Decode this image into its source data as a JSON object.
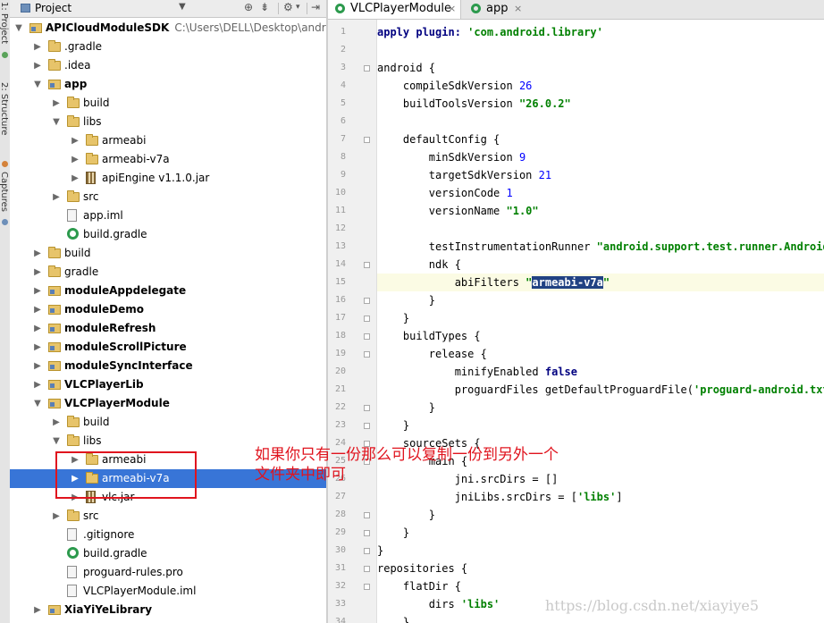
{
  "tool_strip": {
    "tabs": [
      "1: Project",
      "2: Structure",
      "Captures"
    ]
  },
  "project_panel": {
    "title": "Project",
    "dropdown_icon": "triangle-down",
    "header_buttons": [
      "gear-icon",
      "settings-dropdown-icon",
      "collapse-icon"
    ],
    "tree": [
      {
        "label": "APICloudModuleSDK",
        "path": "C:\\Users\\DELL\\Desktop\\andro",
        "type": "module",
        "depth": 0,
        "arrow": "▼",
        "bold": true
      },
      {
        "label": ".gradle",
        "type": "folder",
        "depth": 1,
        "arrow": "▶"
      },
      {
        "label": ".idea",
        "type": "folder",
        "depth": 1,
        "arrow": "▶"
      },
      {
        "label": "app",
        "type": "module",
        "depth": 1,
        "arrow": "▼",
        "bold": true
      },
      {
        "label": "build",
        "type": "folder",
        "depth": 2,
        "arrow": "▶"
      },
      {
        "label": "libs",
        "type": "folder",
        "depth": 2,
        "arrow": "▼"
      },
      {
        "label": "armeabi",
        "type": "folder",
        "depth": 3,
        "arrow": "▶"
      },
      {
        "label": "armeabi-v7a",
        "type": "folder",
        "depth": 3,
        "arrow": "▶"
      },
      {
        "label": "apiEngine v1.1.0.jar",
        "type": "jar",
        "depth": 3,
        "arrow": "▶"
      },
      {
        "label": "src",
        "type": "folder",
        "depth": 2,
        "arrow": "▶"
      },
      {
        "label": "app.iml",
        "type": "file",
        "depth": 2,
        "arrow": ""
      },
      {
        "label": "build.gradle",
        "type": "gradle",
        "depth": 2,
        "arrow": ""
      },
      {
        "label": "build",
        "type": "folder",
        "depth": 1,
        "arrow": "▶"
      },
      {
        "label": "gradle",
        "type": "folder",
        "depth": 1,
        "arrow": "▶"
      },
      {
        "label": "moduleAppdelegate",
        "type": "module",
        "depth": 1,
        "arrow": "▶",
        "bold": true
      },
      {
        "label": "moduleDemo",
        "type": "module",
        "depth": 1,
        "arrow": "▶",
        "bold": true
      },
      {
        "label": "moduleRefresh",
        "type": "module",
        "depth": 1,
        "arrow": "▶",
        "bold": true
      },
      {
        "label": "moduleScrollPicture",
        "type": "module",
        "depth": 1,
        "arrow": "▶",
        "bold": true
      },
      {
        "label": "moduleSyncInterface",
        "type": "module",
        "depth": 1,
        "arrow": "▶",
        "bold": true
      },
      {
        "label": "VLCPlayerLib",
        "type": "module",
        "depth": 1,
        "arrow": "▶",
        "bold": true
      },
      {
        "label": "VLCPlayerModule",
        "type": "module",
        "depth": 1,
        "arrow": "▼",
        "bold": true
      },
      {
        "label": "build",
        "type": "folder",
        "depth": 2,
        "arrow": "▶"
      },
      {
        "label": "libs",
        "type": "folder",
        "depth": 2,
        "arrow": "▼"
      },
      {
        "label": "armeabi",
        "type": "folder",
        "depth": 3,
        "arrow": "▶"
      },
      {
        "label": "armeabi-v7a",
        "type": "folder",
        "depth": 3,
        "arrow": "▶",
        "selected": true
      },
      {
        "label": "vlc.jar",
        "type": "jar",
        "depth": 3,
        "arrow": "▶"
      },
      {
        "label": "src",
        "type": "folder",
        "depth": 2,
        "arrow": "▶"
      },
      {
        "label": ".gitignore",
        "type": "file",
        "depth": 2,
        "arrow": ""
      },
      {
        "label": "build.gradle",
        "type": "gradle",
        "depth": 2,
        "arrow": ""
      },
      {
        "label": "proguard-rules.pro",
        "type": "file",
        "depth": 2,
        "arrow": ""
      },
      {
        "label": "VLCPlayerModule.iml",
        "type": "file",
        "depth": 2,
        "arrow": ""
      },
      {
        "label": "XiaYiYeLibrary",
        "type": "module",
        "depth": 1,
        "arrow": "▶",
        "bold": true
      }
    ]
  },
  "editor": {
    "tabs": [
      {
        "label": "VLCPlayerModule",
        "active": true,
        "close": "×"
      },
      {
        "label": "app",
        "active": false,
        "close": "×"
      }
    ],
    "caret_line": 15,
    "lines": [
      [
        [
          "kw",
          "apply plugin: "
        ],
        [
          "str",
          "'com.android.library'"
        ]
      ],
      [],
      [
        [
          "t",
          "android {"
        ]
      ],
      [
        [
          "t",
          "    compileSdkVersion "
        ],
        [
          "num",
          "26"
        ]
      ],
      [
        [
          "t",
          "    buildToolsVersion "
        ],
        [
          "str",
          "\"26.0.2\""
        ]
      ],
      [],
      [
        [
          "t",
          "    defaultConfig {"
        ]
      ],
      [
        [
          "t",
          "        minSdkVersion "
        ],
        [
          "num",
          "9"
        ]
      ],
      [
        [
          "t",
          "        targetSdkVersion "
        ],
        [
          "num",
          "21"
        ]
      ],
      [
        [
          "t",
          "        versionCode "
        ],
        [
          "num",
          "1"
        ]
      ],
      [
        [
          "t",
          "        versionName "
        ],
        [
          "str",
          "\"1.0\""
        ]
      ],
      [],
      [
        [
          "t",
          "        testInstrumentationRunner "
        ],
        [
          "str",
          "\"android.support.test.runner.AndroidJ"
        ]
      ],
      [
        [
          "t",
          "        ndk {"
        ]
      ],
      [
        [
          "t",
          "            abiFilters "
        ],
        [
          "str",
          "\""
        ],
        [
          "sel",
          "armeabi-v7a"
        ],
        [
          "str",
          "\""
        ]
      ],
      [
        [
          "t",
          "        }"
        ]
      ],
      [
        [
          "t",
          "    }"
        ]
      ],
      [
        [
          "t",
          "    buildTypes {"
        ]
      ],
      [
        [
          "t",
          "        release {"
        ]
      ],
      [
        [
          "t",
          "            minifyEnabled "
        ],
        [
          "kw",
          "false"
        ]
      ],
      [
        [
          "t",
          "            proguardFiles getDefaultProguardFile("
        ],
        [
          "str",
          "'proguard-android.txt'"
        ]
      ],
      [
        [
          "t",
          "        }"
        ]
      ],
      [
        [
          "t",
          "    }"
        ]
      ],
      [
        [
          "t",
          "    sourceSets {"
        ]
      ],
      [
        [
          "t",
          "        main {"
        ]
      ],
      [
        [
          "t",
          "            jni.srcDirs = []"
        ]
      ],
      [
        [
          "t",
          "            jniLibs.srcDirs = ["
        ],
        [
          "str",
          "'libs'"
        ],
        [
          "t",
          "]"
        ]
      ],
      [
        [
          "t",
          "        }"
        ]
      ],
      [
        [
          "t",
          "    }"
        ]
      ],
      [
        [
          "t",
          "}"
        ]
      ],
      [
        [
          "t",
          "repositories {"
        ]
      ],
      [
        [
          "t",
          "    flatDir {"
        ]
      ],
      [
        [
          "t",
          "        dirs "
        ],
        [
          "str",
          "'libs'"
        ]
      ],
      [
        [
          "t",
          "    }"
        ]
      ]
    ]
  },
  "annotation": {
    "text": "如果你只有一份那么可以复制一份到另外一个文件夹中即可",
    "color": "#e0141e"
  },
  "watermark": "https://blog.csdn.net/xiayiye5",
  "colors": {
    "selection": "#3875d7",
    "keyword": "#000080",
    "string": "#008000",
    "number": "#0000ff",
    "annotation_red": "#e0141e"
  }
}
